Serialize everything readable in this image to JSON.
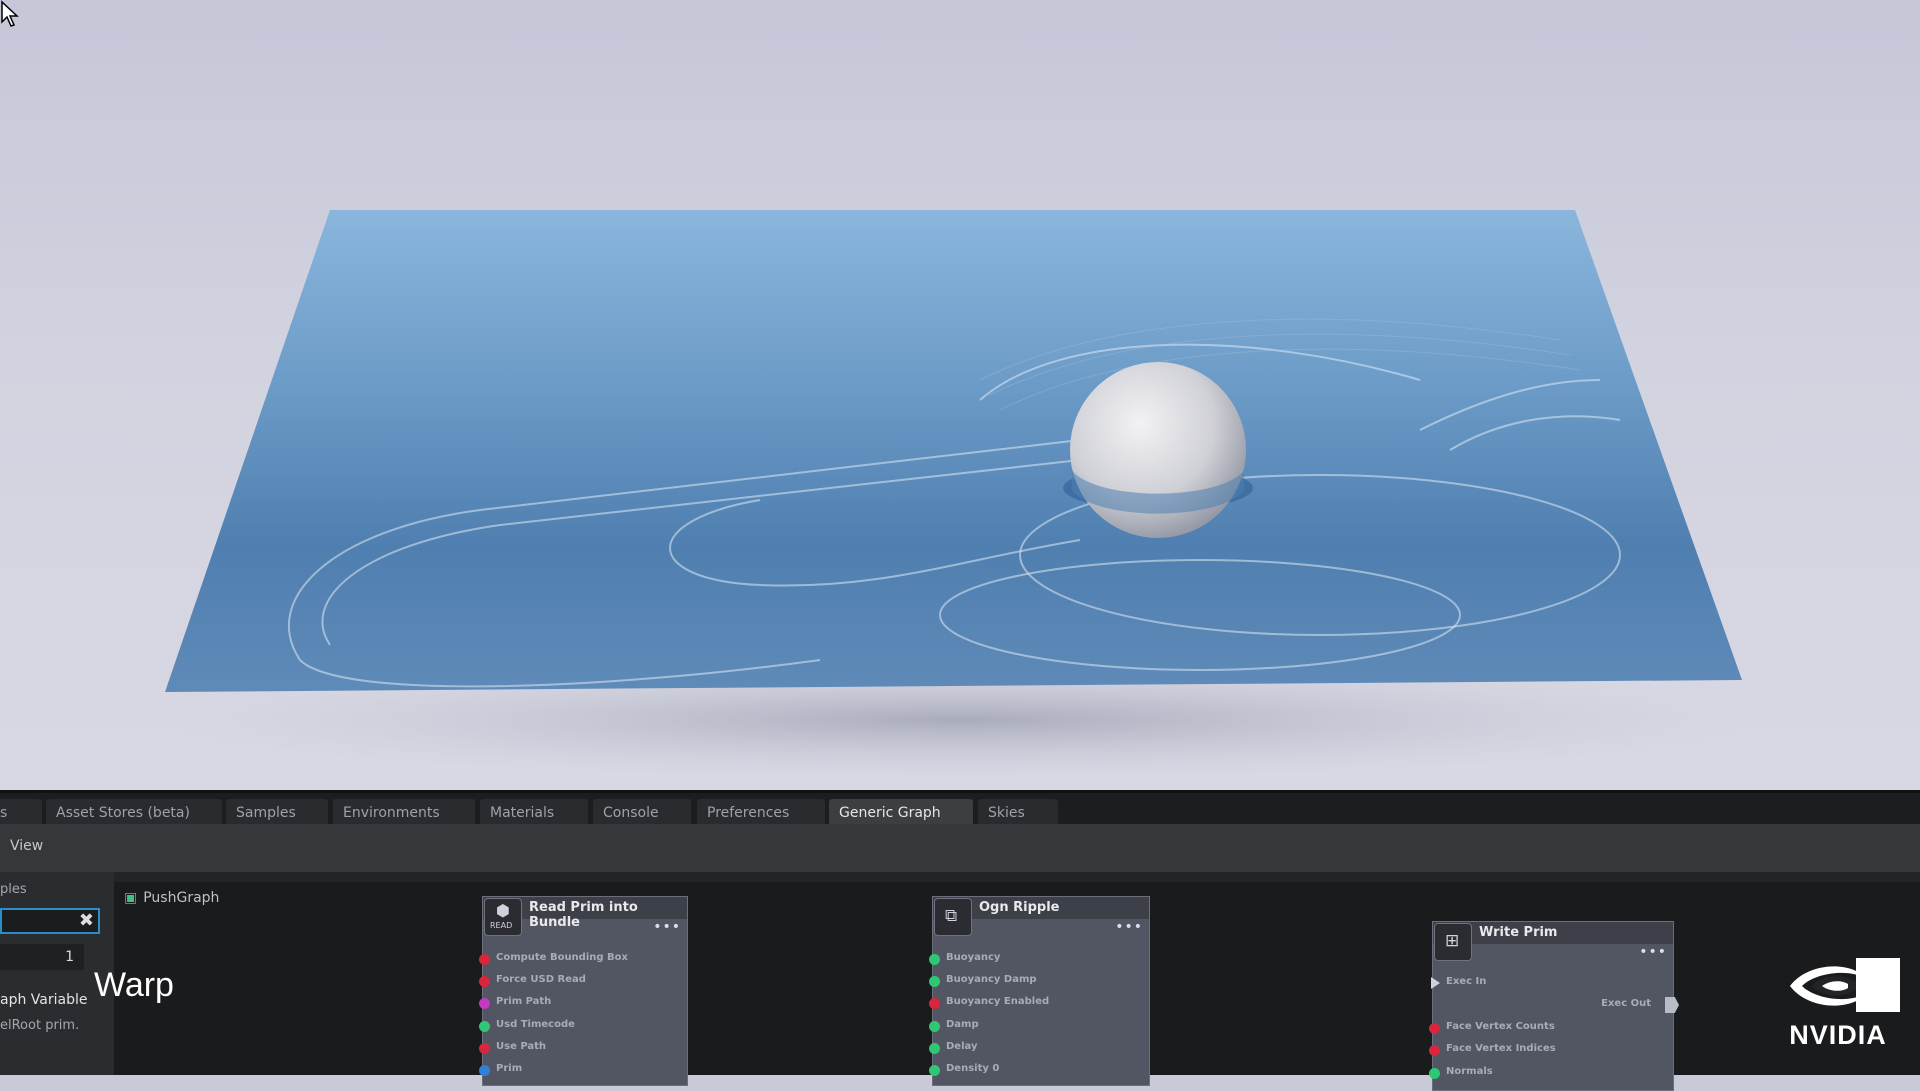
{
  "tabs": [
    {
      "label": "s",
      "active": false
    },
    {
      "label": "Asset Stores (beta)",
      "active": false
    },
    {
      "label": "Samples",
      "active": false
    },
    {
      "label": "Environments",
      "active": false
    },
    {
      "label": "Materials",
      "active": false
    },
    {
      "label": "Console",
      "active": false
    },
    {
      "label": "Preferences",
      "active": false
    },
    {
      "label": "Generic Graph",
      "active": true
    },
    {
      "label": "Skies",
      "active": false
    }
  ],
  "toolbar": {
    "view_label": "View"
  },
  "left_panel": {
    "section_label": "ples",
    "number_value": "1",
    "variable_label": "aph Variable",
    "description": "elRoot prim."
  },
  "graph": {
    "name": "PushGraph",
    "nodes": [
      {
        "title": "Read Prim into Bundle",
        "icon": "read-icon",
        "icon_label": "READ",
        "ports": [
          {
            "label": "Compute Bounding Box",
            "color": "#d8263c"
          },
          {
            "label": "Force USD Read",
            "color": "#d8263c"
          },
          {
            "label": "Prim Path",
            "color": "#c03bc0"
          },
          {
            "label": "Usd Timecode",
            "color": "#2ec874"
          },
          {
            "label": "Use Path",
            "color": "#d8263c"
          },
          {
            "label": "Prim",
            "color": "#2f80d8"
          }
        ]
      },
      {
        "title": "Ogn Ripple",
        "icon": "script-icon",
        "ports": [
          {
            "label": "Buoyancy",
            "color": "#2ec874"
          },
          {
            "label": "Buoyancy Damp",
            "color": "#2ec874"
          },
          {
            "label": "Buoyancy Enabled",
            "color": "#d8263c"
          },
          {
            "label": "Damp",
            "color": "#2ec874"
          },
          {
            "label": "Delay",
            "color": "#2ec874"
          },
          {
            "label": "Density 0",
            "color": "#2ec874"
          }
        ]
      },
      {
        "title": "Write Prim",
        "icon": "write-icon",
        "exec_in": "Exec In",
        "exec_out": "Exec Out",
        "ports": [
          {
            "label": "Face Vertex Counts",
            "color": "#d8263c"
          },
          {
            "label": "Face Vertex Indices",
            "color": "#d8263c"
          },
          {
            "label": "Normals",
            "color": "#2ec874"
          }
        ]
      }
    ]
  },
  "overlay": {
    "caption": "Warp",
    "brand": "NVIDIA"
  },
  "colors": {
    "water": "#5b8fc0",
    "panel_bg": "#232427",
    "accent_border": "#2b8ec4"
  }
}
